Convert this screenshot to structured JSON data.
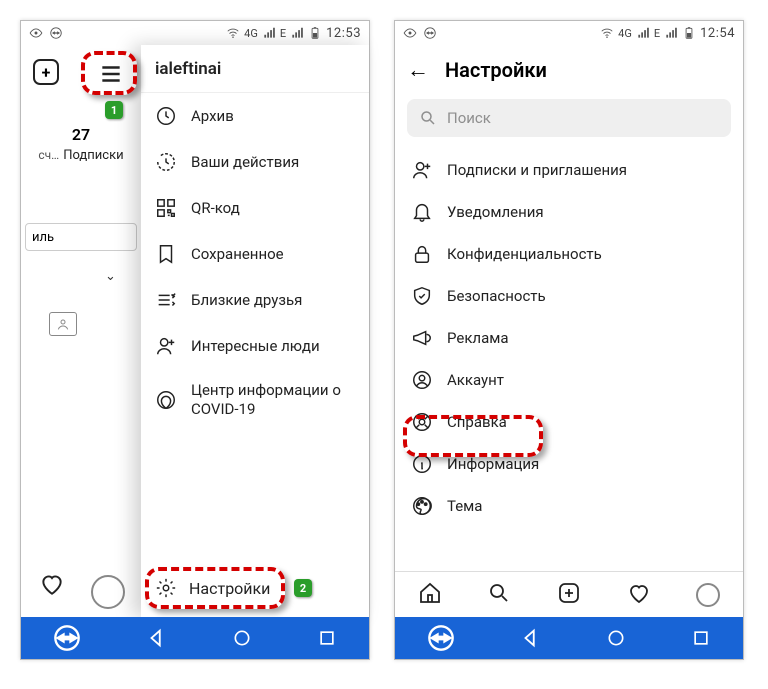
{
  "status": {
    "network_label": "4G",
    "signal_e": "E",
    "clock_left": "12:53",
    "clock_right": "12:54"
  },
  "phone1": {
    "username": "ialeftinai",
    "count": {
      "value": "27",
      "label": "Подписки",
      "trunc": "сч…"
    },
    "edit_label": "иль",
    "menu": [
      {
        "label": "Архив"
      },
      {
        "label": "Ваши действия"
      },
      {
        "label": "QR-код"
      },
      {
        "label": "Сохраненное"
      },
      {
        "label": "Близкие друзья"
      },
      {
        "label": "Интересные люди"
      },
      {
        "label": "Центр информации о COVID-19"
      }
    ],
    "settings_label": "Настройки"
  },
  "phone2": {
    "title": "Настройки",
    "search_placeholder": "Поиск",
    "items": [
      {
        "label": "Подписки и приглашения"
      },
      {
        "label": "Уведомления"
      },
      {
        "label": "Конфиденциальность"
      },
      {
        "label": "Безопасность"
      },
      {
        "label": "Реклама"
      },
      {
        "label": "Аккаунт"
      },
      {
        "label": "Справка"
      },
      {
        "label": "Информация"
      },
      {
        "label": "Тема"
      }
    ]
  },
  "steps": {
    "s1": "1",
    "s2": "2"
  }
}
